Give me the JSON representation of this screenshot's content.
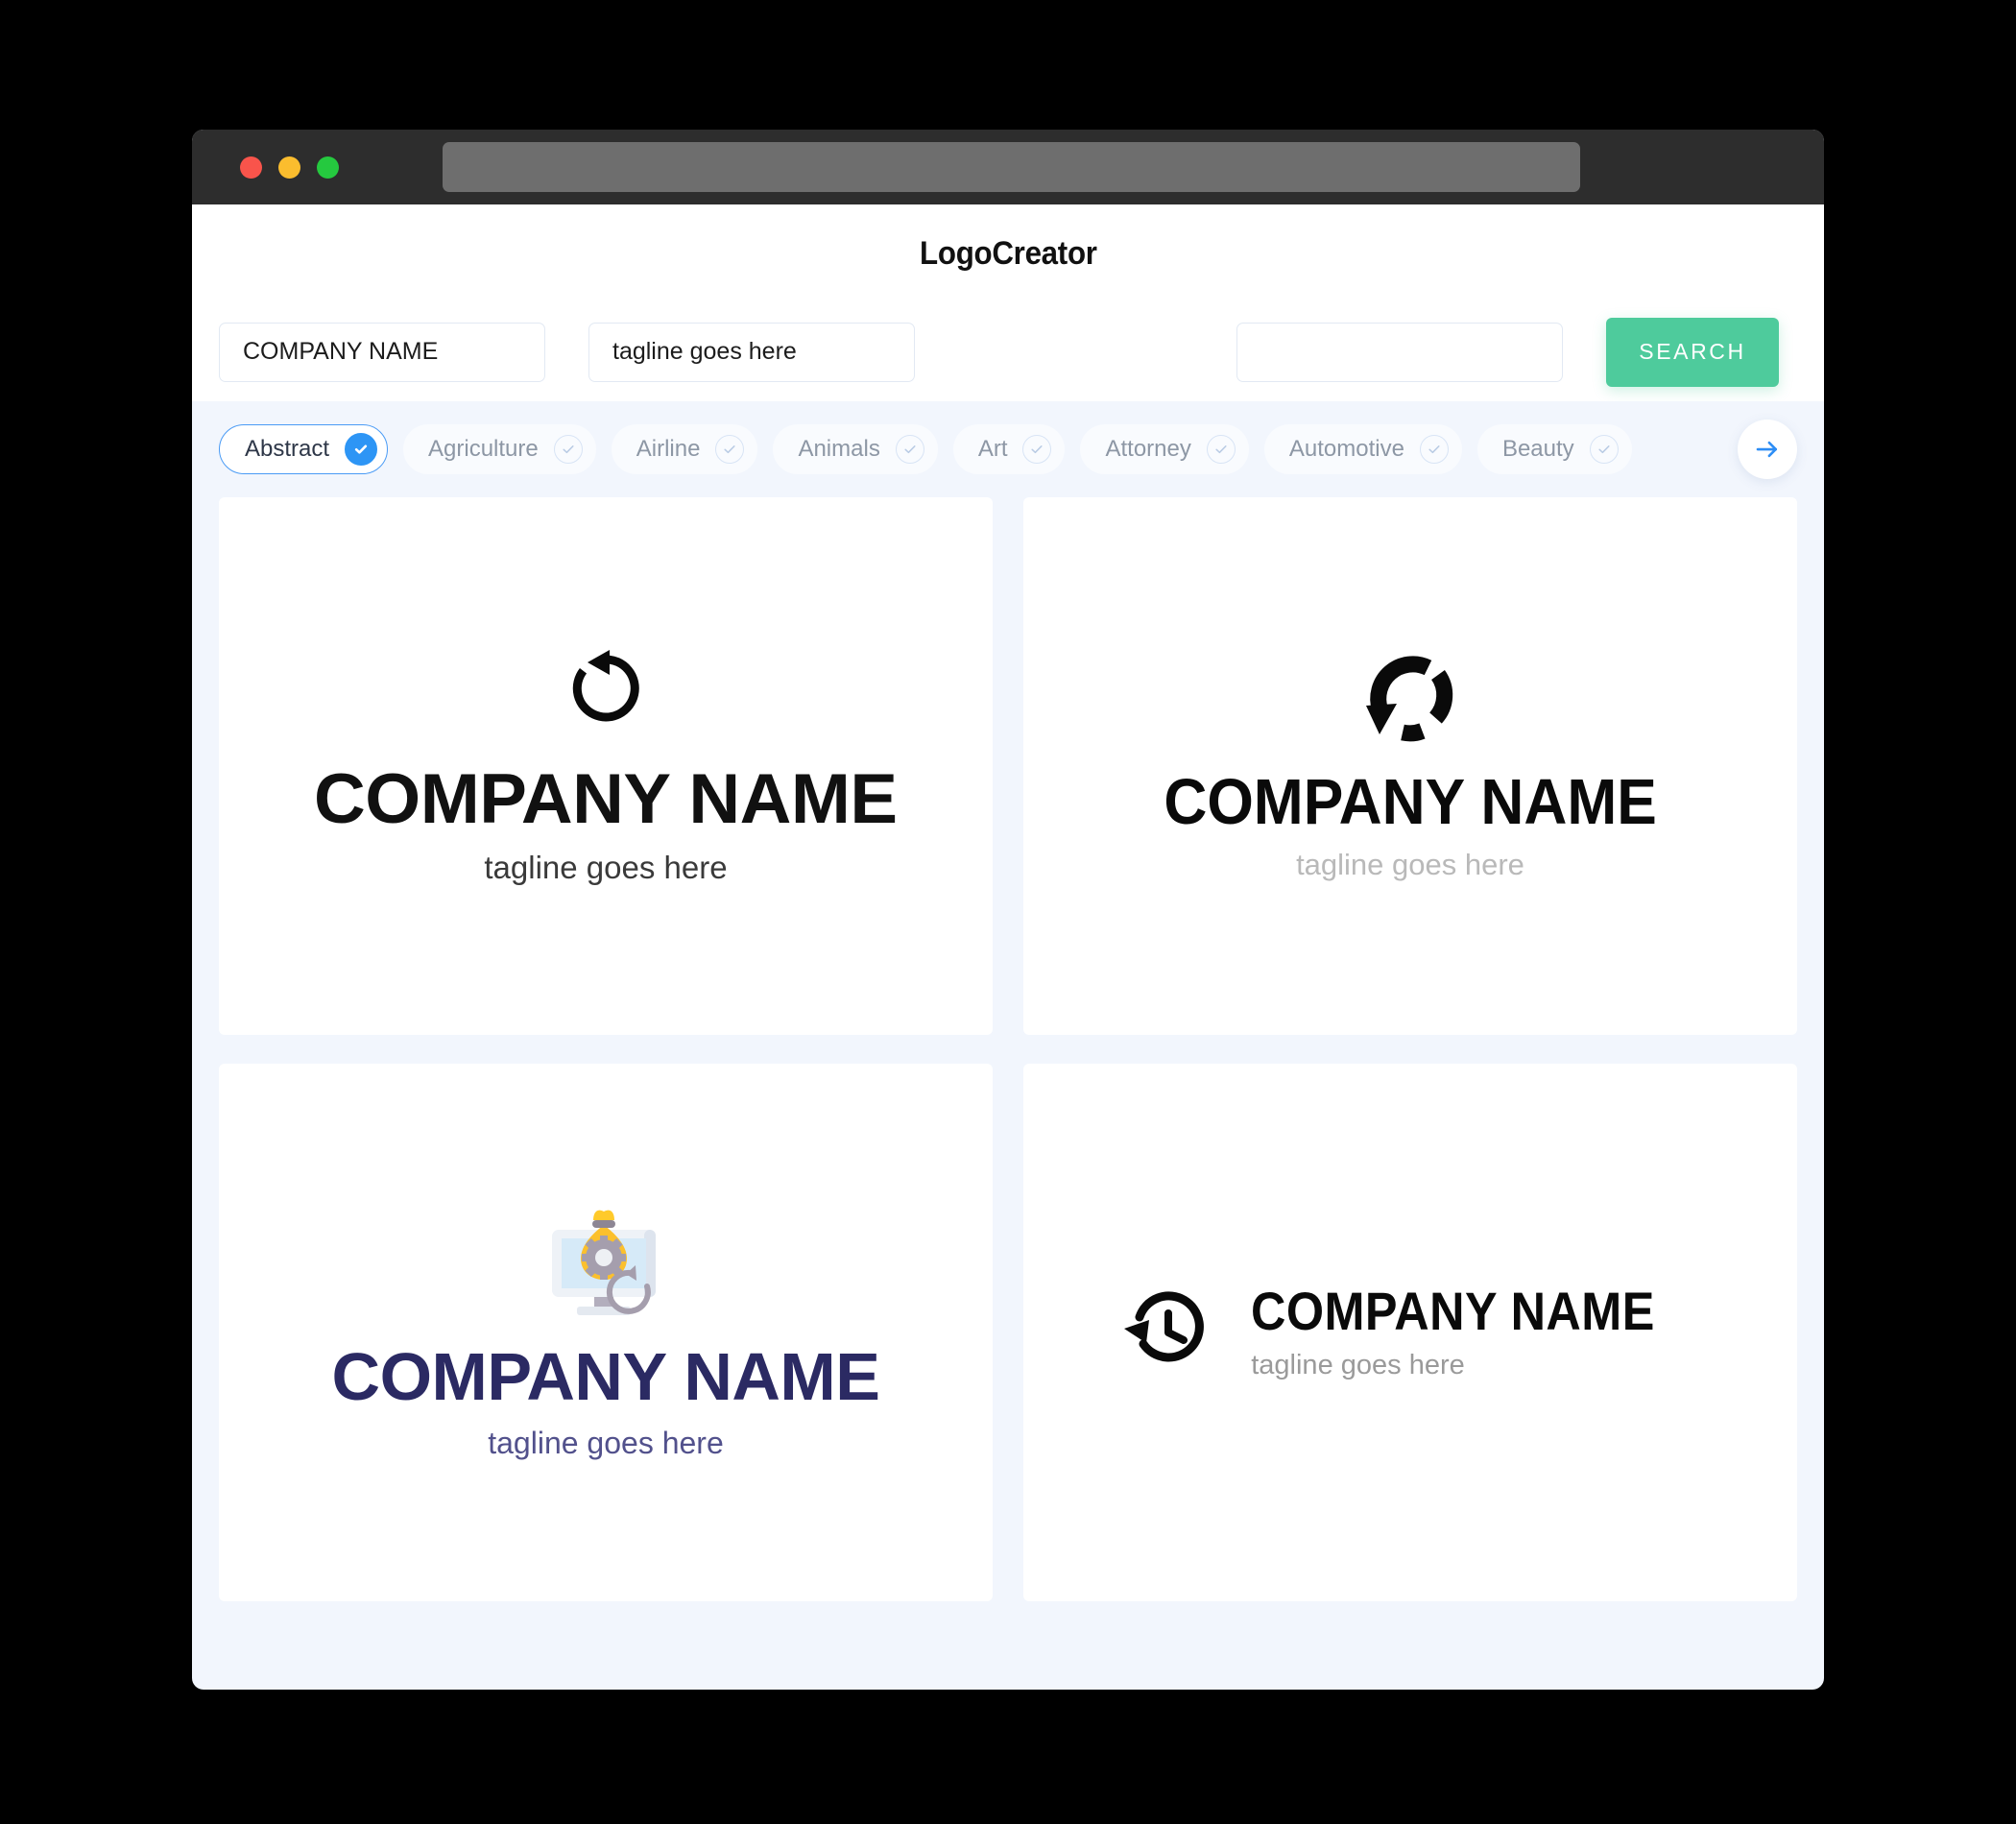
{
  "window": {
    "traffic_lights": [
      "close",
      "minimize",
      "maximize"
    ],
    "url_bar_value": ""
  },
  "header": {
    "title": "LogoCreator"
  },
  "search": {
    "company_name_value": "COMPANY NAME",
    "tagline_value": "tagline goes here",
    "extra_value": "",
    "search_button_label": "SEARCH"
  },
  "categories": {
    "next_button_label": "next",
    "items": [
      {
        "label": "Abstract",
        "selected": true
      },
      {
        "label": "Agriculture",
        "selected": false
      },
      {
        "label": "Airline",
        "selected": false
      },
      {
        "label": "Animals",
        "selected": false
      },
      {
        "label": "Art",
        "selected": false
      },
      {
        "label": "Attorney",
        "selected": false
      },
      {
        "label": "Automotive",
        "selected": false
      },
      {
        "label": "Beauty",
        "selected": false
      }
    ]
  },
  "logos": [
    {
      "icon": "rotate-left-icon",
      "name": "COMPANY NAME",
      "tagline": "tagline goes here",
      "name_color": "#111111",
      "tagline_color": "#3a3a3a",
      "layout": "stacked"
    },
    {
      "icon": "segmented-refresh-icon",
      "name": "COMPANY NAME",
      "tagline": "tagline goes here",
      "name_color": "#0a0a0a",
      "tagline_color": "#b9b9b9",
      "layout": "stacked"
    },
    {
      "icon": "monitor-money-gear-icon",
      "name": "COMPANY NAME",
      "tagline": "tagline goes here",
      "name_color": "#2b2a63",
      "tagline_color": "#52518c",
      "layout": "stacked"
    },
    {
      "icon": "clock-history-icon",
      "name": "COMPANY NAME",
      "tagline": "tagline goes here",
      "name_color": "#0a0a0a",
      "tagline_color": "#9a9a9a",
      "layout": "row"
    }
  ],
  "colors": {
    "page_background": "#f2f6fd",
    "card_background": "#ffffff",
    "accent_green": "#4ecb9c",
    "accent_blue": "#2d95f5",
    "chrome_dark": "#2d2d2d",
    "traffic_red": "#f9544b",
    "traffic_yellow": "#fbbd2e",
    "traffic_green": "#25c93f"
  }
}
